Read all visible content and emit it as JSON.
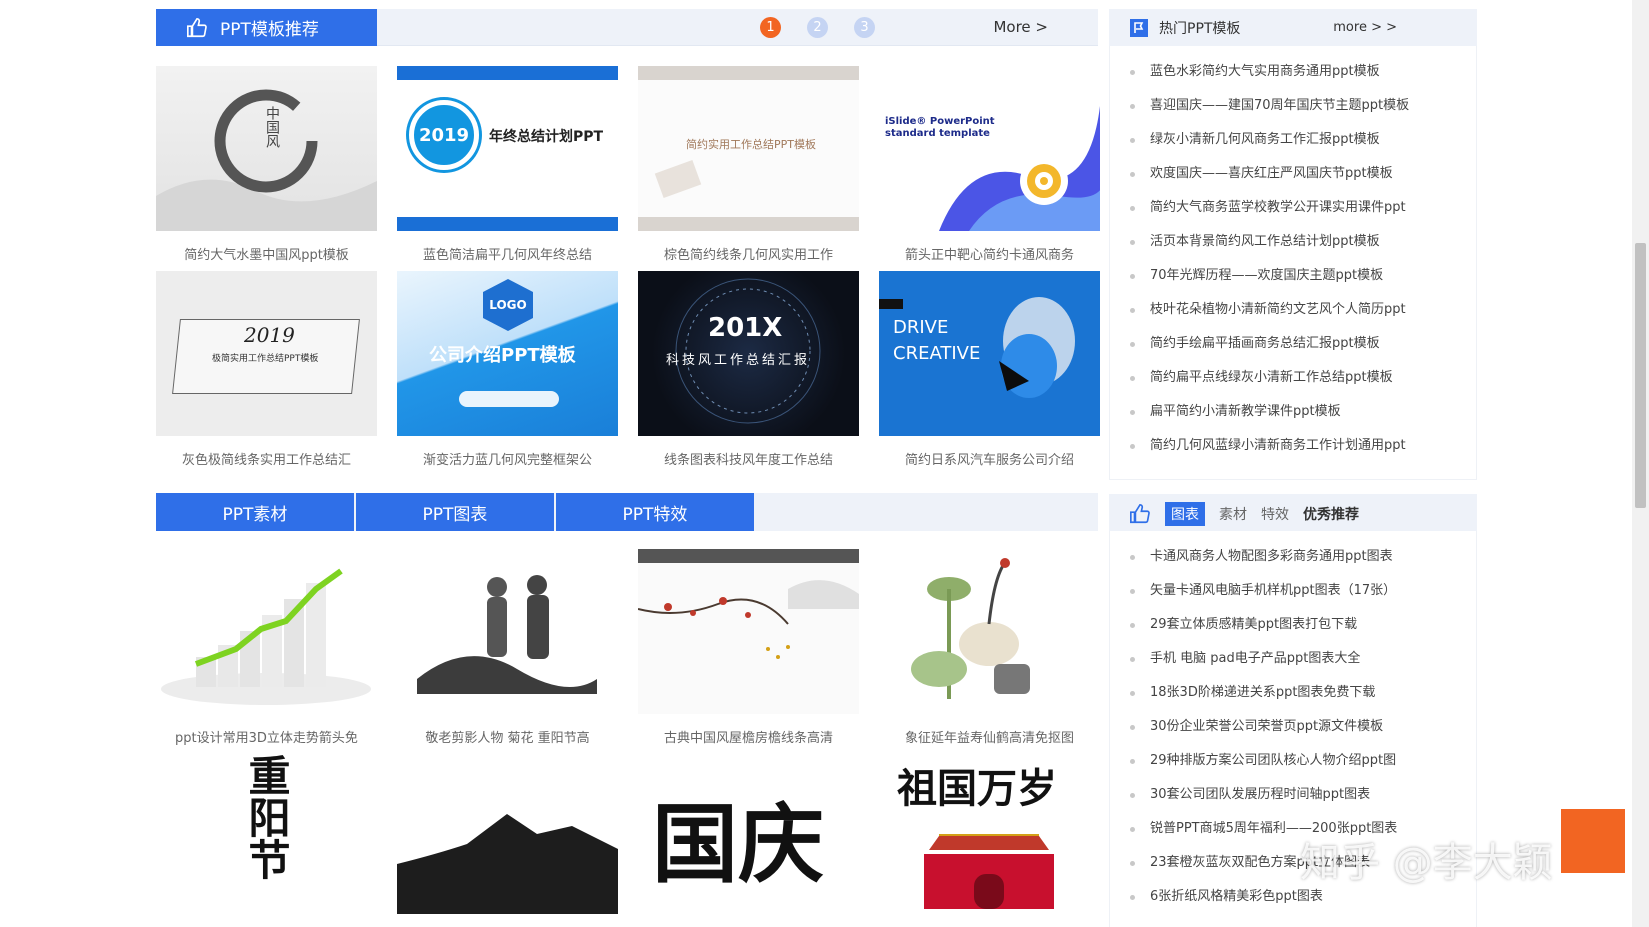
{
  "templates": {
    "title": "PPT模板推荐",
    "pages": [
      "1",
      "2",
      "3"
    ],
    "more": "More >",
    "items": [
      "简约大气水墨中国风ppt模板",
      "蓝色简洁扁平几何风年终总结",
      "棕色简约线条几何风实用工作",
      "箭头正中靶心简约卡通风商务",
      "灰色极简线条实用工作总结汇",
      "渐变活力蓝几何风完整框架公",
      "线条图表科技风年度工作总结",
      "简约日系风汽车服务公司介绍"
    ],
    "thumb_text": {
      "t1": "中国风",
      "t2_badge": "2019",
      "t2_title": "年终总结计划PPT",
      "t3": "简约实用工作总结PPT模板",
      "t4": "iSlide® PowerPoint standard template",
      "t5_year": "2019",
      "t5_title": "极简实用工作总结PPT模板",
      "t6_logo": "LOGO",
      "t6_title": "公司介绍PPT模板",
      "t7_year": "201X",
      "t7_title": "科技风工作总结汇报",
      "t8": "DRIVE CREATIVE"
    }
  },
  "materials": {
    "tabs": [
      "PPT素材",
      "PPT图表",
      "PPT特效"
    ],
    "items": [
      "ppt设计常用3D立体走势箭头免",
      "敬老剪影人物 菊花 重阳节高",
      "古典中国风屋檐房檐线条高清",
      "象征延年益寿仙鹤高清免抠图"
    ],
    "row2_text": {
      "c1": "重阳节",
      "c3": "国庆",
      "c4": "祖国万岁"
    }
  },
  "hot": {
    "title": "热门PPT模板",
    "more": "more > >",
    "items": [
      "蓝色水彩简约大气实用商务通用ppt模板",
      "喜迎国庆——建国70周年国庆节主题ppt模板",
      "绿灰小清新几何风商务工作汇报ppt模板",
      "欢度国庆——喜庆红庄严风国庆节ppt模板",
      "简约大气商务蓝学校教学公开课实用课件ppt",
      "活页本背景简约风工作总结计划ppt模板",
      "70年光辉历程——欢度国庆主题ppt模板",
      "枝叶花朵植物小清新简约文艺风个人简历ppt",
      "简约手绘扁平插画商务总结汇报ppt模板",
      "简约扁平点线绿灰小清新工作总结ppt模板",
      "扁平简约小清新教学课件ppt模板",
      "简约几何风蓝绿小清新商务工作计划通用ppt"
    ]
  },
  "charts_box": {
    "tabs": [
      "图表",
      "素材",
      "特效",
      "优秀推荐"
    ],
    "items": [
      "卡通风商务人物配图多彩商务通用ppt图表",
      "矢量卡通风电脑手机样机ppt图表（17张）",
      "29套立体质感精美ppt图表打包下载",
      "手机 电脑 pad电子产品ppt图表大全",
      "18张3D阶梯递进关系ppt图表免费下载",
      "30份企业荣誉公司荣誉页ppt源文件模板",
      "29种排版方案公司团队核心人物介绍ppt图",
      "30套公司团队发展历程时间轴ppt图表",
      "锐普PPT商城5周年福利——200张ppt图表",
      "23套橙灰蓝灰双配色方案ppt立体图表",
      "6张折纸风格精美彩色ppt图表"
    ]
  },
  "watermark": "知乎 @李大颖",
  "colors": {
    "accent": "#2f6fe8",
    "pager_active": "#f26522"
  }
}
